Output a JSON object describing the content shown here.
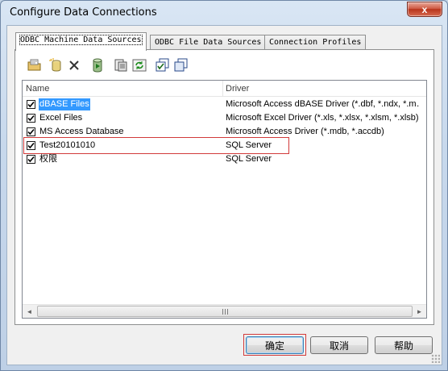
{
  "window": {
    "title": "Configure Data Connections",
    "close_label": "x"
  },
  "tabs": [
    {
      "label": "ODBC Machine Data Sources",
      "active": true
    },
    {
      "label": "ODBC File Data Sources",
      "active": false
    },
    {
      "label": "Connection Profiles",
      "active": false
    }
  ],
  "toolbar": {
    "buttons": [
      "open-folder-icon",
      "new-database-icon",
      "delete-icon",
      "run-icon",
      "properties-icon",
      "refresh-icon",
      "check-all-icon",
      "copy-icon"
    ]
  },
  "list": {
    "columns": {
      "name": "Name",
      "driver": "Driver"
    },
    "rows": [
      {
        "name": "dBASE Files",
        "driver": "Microsoft Access dBASE Driver (*.dbf, *.ndx, *.m…",
        "checked": true,
        "selected": true
      },
      {
        "name": "Excel Files",
        "driver": "Microsoft Excel Driver (*.xls, *.xlsx, *.xlsm, *.xlsb)",
        "checked": true,
        "selected": false
      },
      {
        "name": "MS Access Database",
        "driver": "Microsoft Access Driver (*.mdb, *.accdb)",
        "checked": true,
        "selected": false
      },
      {
        "name": "Test20101010",
        "driver": "SQL Server",
        "checked": true,
        "selected": false,
        "highlighted": true
      },
      {
        "name": "权限",
        "driver": "SQL Server",
        "checked": true,
        "selected": false
      }
    ],
    "scroll_left_glyph": "◄",
    "scroll_right_glyph": "►"
  },
  "buttons": {
    "ok": "确定",
    "cancel": "取消",
    "help": "帮助"
  },
  "colors": {
    "selection": "#3399ff",
    "highlight_box": "#d23a3a"
  }
}
